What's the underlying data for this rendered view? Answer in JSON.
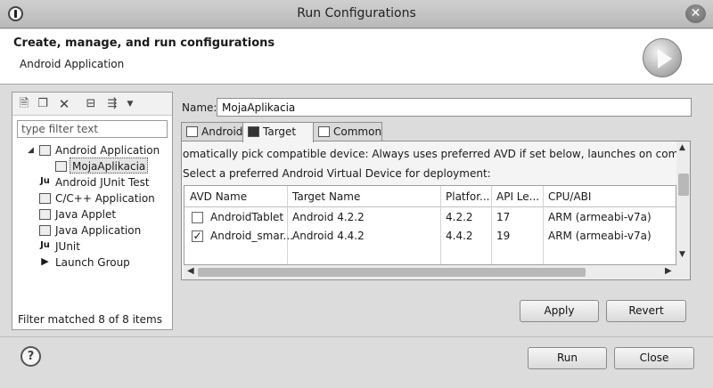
{
  "window": {
    "title": "Run Configurations",
    "close_glyph": "✕"
  },
  "banner": {
    "heading": "Create, manage, and run configurations",
    "subheading": "Android Application",
    "icon": "run-icon"
  },
  "left_panel": {
    "toolbar_icons": [
      "new-configuration-icon",
      "duplicate-icon",
      "delete-icon",
      "collapse-all-icon",
      "filter-icon",
      "dropdown-arrow-icon"
    ],
    "filter": {
      "value": "",
      "placeholder": "type filter text"
    },
    "tree": [
      {
        "label": "Android Application",
        "expanded": true,
        "level": 0,
        "icon": "android-app-icon"
      },
      {
        "label": "MojaAplikacia",
        "level": 1,
        "selected": true,
        "icon": "android-app-icon"
      },
      {
        "label": "Android JUnit Test",
        "level": 0,
        "icon": "junit-icon"
      },
      {
        "label": "C/C++ Application",
        "level": 0,
        "icon": "cpp-app-icon"
      },
      {
        "label": "Java Applet",
        "level": 0,
        "icon": "java-applet-icon"
      },
      {
        "label": "Java Application",
        "level": 0,
        "icon": "java-app-icon"
      },
      {
        "label": "JUnit",
        "level": 0,
        "icon": "junit-icon"
      },
      {
        "label": "Launch Group",
        "level": 0,
        "icon": "launch-group-icon"
      }
    ],
    "status": "Filter matched 8 of 8 items"
  },
  "config": {
    "name_label": "Name:",
    "name_value": "MojaAplikacia",
    "tabs": [
      {
        "label": "Android",
        "active": false,
        "icon": "android-tab-icon"
      },
      {
        "label": "Target",
        "active": true,
        "icon": "target-tab-icon"
      },
      {
        "label": "Common",
        "active": false,
        "icon": "common-tab-icon"
      }
    ],
    "target": {
      "auto_pick_text": "omatically pick compatible device: Always uses preferred AVD if set below, launches on compatible devic",
      "select_text": "Select a preferred Android Virtual Device for deployment:",
      "columns": [
        "AVD Name",
        "Target Name",
        "Platfor...",
        "API Le...",
        "CPU/ABI"
      ],
      "rows": [
        {
          "checked": false,
          "avd": "AndroidTablet",
          "target": "Android 4.2.2",
          "platform": "4.2.2",
          "api": "17",
          "cpu": "ARM (armeabi-v7a)"
        },
        {
          "checked": true,
          "avd": "Android_smar...",
          "target": "Android 4.4.2",
          "platform": "4.4.2",
          "api": "19",
          "cpu": "ARM (armeabi-v7a)"
        }
      ]
    },
    "apply_label": "Apply",
    "revert_label": "Revert"
  },
  "footer": {
    "help_glyph": "?",
    "run_label": "Run",
    "close_label": "Close"
  }
}
